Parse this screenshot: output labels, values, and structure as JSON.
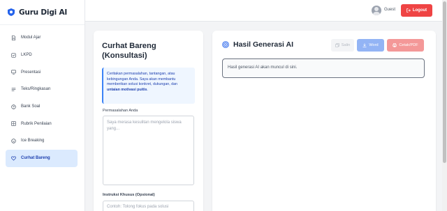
{
  "app": {
    "brand": "Guru Digi AI"
  },
  "sidebar": {
    "items": [
      {
        "label": "Modul Ajar",
        "icon": "document-icon",
        "active": false
      },
      {
        "label": "LKPD",
        "icon": "checkbox-icon",
        "active": false
      },
      {
        "label": "Presentasi",
        "icon": "monitor-icon",
        "active": false
      },
      {
        "label": "Teks/Ringkasan",
        "icon": "text-lines-icon",
        "active": false
      },
      {
        "label": "Bank Soal",
        "icon": "question-circle-icon",
        "active": false
      },
      {
        "label": "Rubrik Penilaian",
        "icon": "grid-icon",
        "active": false
      },
      {
        "label": "Ice Breaking",
        "icon": "smile-icon",
        "active": false
      },
      {
        "label": "Curhat Bareng",
        "icon": "heart-icon",
        "active": true
      }
    ]
  },
  "header": {
    "user_name": "Guest",
    "logout_label": "Logout"
  },
  "form": {
    "title": "Curhat Bareng (Konsultasi)",
    "info_text": "Ceritakan permasalahan, tantangan, atau kebingungan Anda. Saya akan membantu memberikan solusi konkret, dukungan, dan",
    "info_emphasis": "untaian motivasi puitis",
    "info_end": ".",
    "problem_label": "Permasalahan Anda",
    "problem_placeholder": "Saya merasa kesulitan mengelola siswa yang...",
    "instruction_label": "Instruksi Khusus (Opsional)",
    "instruction_placeholder": "Contoh: Tolong fokus pada solusi"
  },
  "result": {
    "title": "Hasil Generasi AI",
    "copy_label": "Salin",
    "word_label": "Word",
    "print_label": "Cetak/PDF",
    "placeholder": "Hasil generasi AI akan muncul di sini."
  },
  "colors": {
    "accent": "#3b82f6",
    "danger": "#ef4444",
    "active_bg": "#dbeafe"
  }
}
